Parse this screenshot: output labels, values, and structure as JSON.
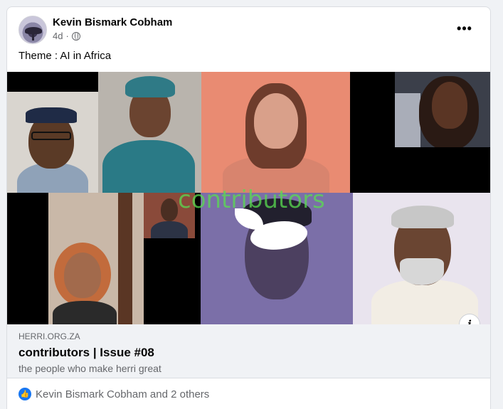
{
  "post": {
    "author": "Kevin Bismark Cobham",
    "time": "4d",
    "separator": "·",
    "privacy_icon": "globe-icon",
    "more_icon": "more-options-icon",
    "more_label": "•••",
    "text": "Theme : AI in Africa"
  },
  "link_preview": {
    "image_overlay_text": "contributors",
    "info_label": "i",
    "domain": "HERRI.ORG.ZA",
    "title": "contributors | Issue #08",
    "description": "the people who make herri great"
  },
  "reactions": {
    "icon": "like-icon",
    "summary": "Kevin Bismark Cobham and 2 others"
  },
  "colors": {
    "accent": "#1877f2",
    "overlay_text": "#5adc50",
    "salmon_tile": "#e98b72",
    "purple_tile": "#7b6fa8"
  }
}
